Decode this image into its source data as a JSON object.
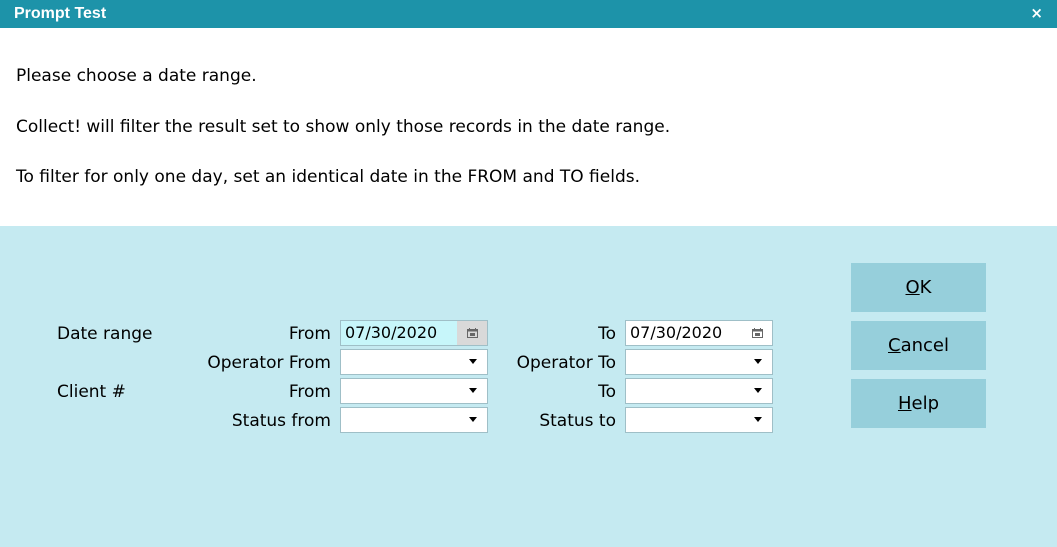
{
  "window": {
    "title": "Prompt Test",
    "close_glyph": "×"
  },
  "message": {
    "line1": "Please choose a date range.",
    "line2": "Collect! will filter the result set to show only those records in the date range.",
    "line3": "To filter for only one day, set an identical date in the FROM and TO fields."
  },
  "form": {
    "date_range_label": "Date range",
    "client_label": "Client #",
    "from_label": "From",
    "to_label": "To",
    "operator_from_label": "Operator From",
    "operator_to_label": "Operator To",
    "client_from_label": "From",
    "client_to_label": "To",
    "status_from_label": "Status from",
    "status_to_label": "Status to",
    "date_from_value": "07/30/2020",
    "date_to_value": "07/30/2020",
    "operator_from_value": "",
    "operator_to_value": "",
    "client_from_value": "",
    "client_to_value": "",
    "status_from_value": "",
    "status_to_value": ""
  },
  "buttons": {
    "ok_mnemonic": "O",
    "ok_rest": "K",
    "cancel_mnemonic": "C",
    "cancel_rest": "ancel",
    "help_mnemonic": "H",
    "help_rest": "elp"
  },
  "colors": {
    "titlebar": "#1d93a9",
    "panel": "#c5eaf1",
    "button": "#96cfdb",
    "active_field": "#c7f6fa"
  }
}
